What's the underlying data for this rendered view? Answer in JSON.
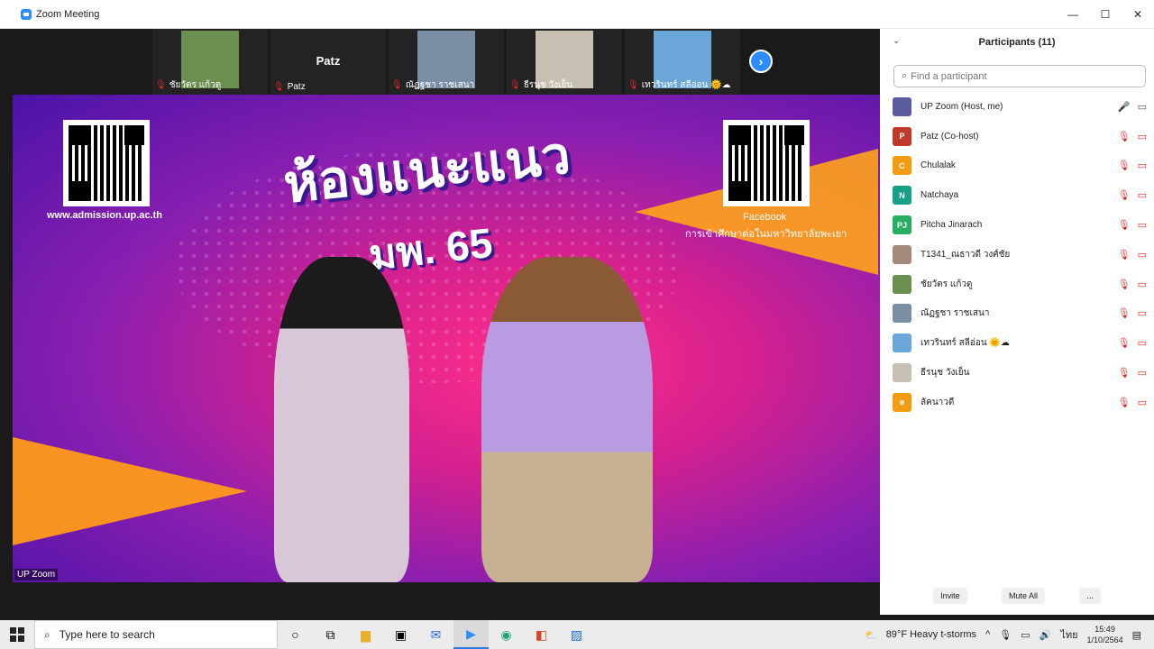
{
  "window": {
    "title": "Zoom Meeting",
    "min": "—",
    "max": "☐",
    "close": "✕"
  },
  "thumbnails": [
    {
      "name": "ชัยวัตร แก้วดู",
      "photo_color": "#6b8f4f"
    },
    {
      "name": "Patz",
      "big_label": "Patz"
    },
    {
      "name": "ณัฏฐชา ราชเสนา",
      "photo_color": "#7a8ea6"
    },
    {
      "name": "ธีรนุช วังเย็น",
      "photo_color": "#c9c0b4"
    },
    {
      "name": "เทวรินทร์ สลีอ่อน 🌞☁",
      "photo_color": "#6aa6d8"
    }
  ],
  "next_icon": "chevron-right-icon",
  "stage": {
    "headline_line1": "ห้องแนะแนว",
    "headline_line2": "มพ. 65",
    "website": "www.admission.up.ac.th",
    "facebook_label": "Facebook",
    "facebook_sub": "การเข้าศึกษาต่อในมหาวิทยาลัยพะเยา",
    "speaker_label": "UP Zoom"
  },
  "participants": {
    "title": "Participants (11)",
    "search_placeholder": "Find a participant",
    "items": [
      {
        "name": "UP Zoom (Host, me)",
        "initials": "",
        "color": "#5b5b9f",
        "mic": "on",
        "cam": "on"
      },
      {
        "name": "Patz (Co-host)",
        "initials": "P",
        "color": "#c0392b",
        "mic": "off",
        "cam": "off"
      },
      {
        "name": "Chulalak",
        "initials": "C",
        "color": "#f39c12",
        "mic": "off",
        "cam": "off"
      },
      {
        "name": "Natchaya",
        "initials": "N",
        "color": "#16a085",
        "mic": "off",
        "cam": "off"
      },
      {
        "name": "Pitcha Jinarach",
        "initials": "PJ",
        "color": "#27ae60",
        "mic": "off",
        "cam": "off"
      },
      {
        "name": "T1341_ณธาวดี วงศ์ชัย",
        "initials": "",
        "color": "#a38a7a",
        "mic": "off",
        "cam": "off"
      },
      {
        "name": "ชัยวัตร แก้วดู",
        "initials": "",
        "color": "#6b8f4f",
        "mic": "off",
        "cam": "off"
      },
      {
        "name": "ณัฏฐชา ราชเสนา",
        "initials": "",
        "color": "#7a8ea6",
        "mic": "off",
        "cam": "off"
      },
      {
        "name": "เทวรินทร์ สลีอ่อน 🌞☁",
        "initials": "",
        "color": "#6aa6d8",
        "mic": "off",
        "cam": "off"
      },
      {
        "name": "ธีรนุช วังเย็น",
        "initials": "",
        "color": "#c9c0b4",
        "mic": "off",
        "cam": "off"
      },
      {
        "name": "ลัคนาวดี",
        "initials": "ล",
        "color": "#f39c12",
        "mic": "off",
        "cam": "off"
      }
    ],
    "invite": "Invite",
    "mute_all": "Mute All",
    "more": "..."
  },
  "taskbar": {
    "search_placeholder": "Type here to search",
    "weather": "89°F  Heavy t-storms",
    "lang": "ไทย",
    "time": "15:49",
    "date": "1/10/2564"
  }
}
